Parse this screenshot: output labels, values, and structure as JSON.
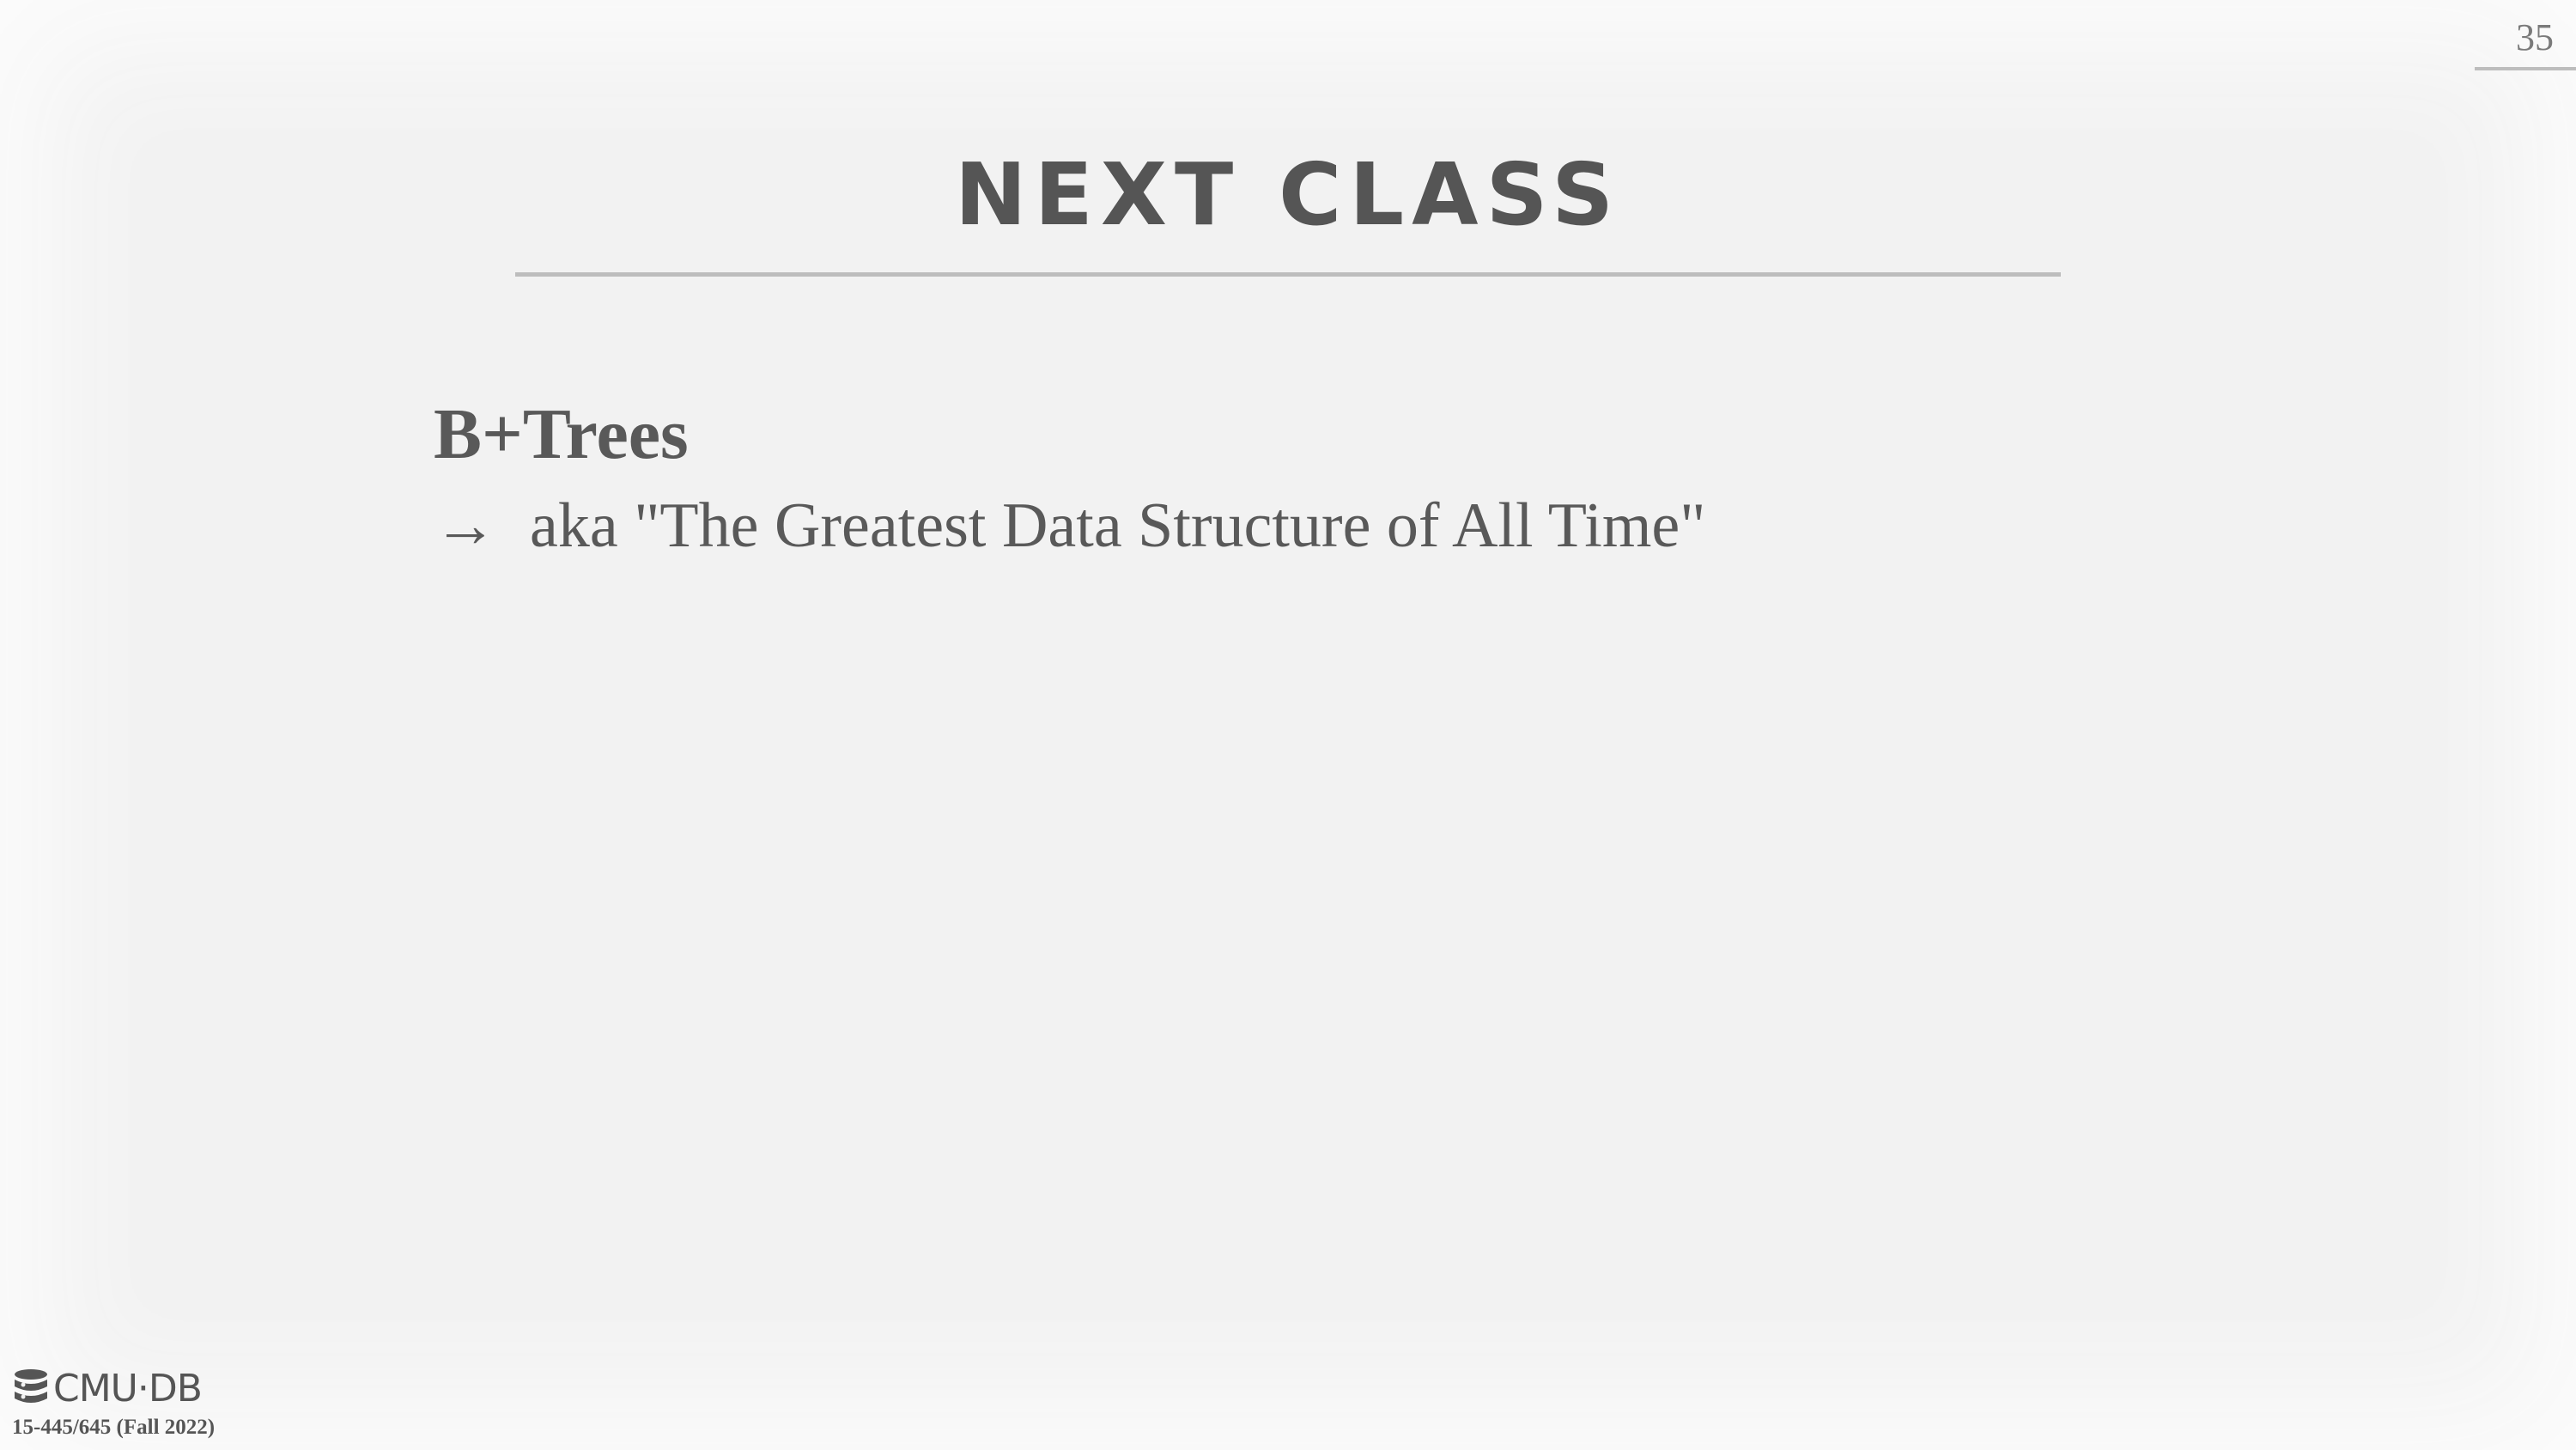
{
  "slide": {
    "page_number": "35",
    "title": "NEXT CLASS",
    "item": {
      "heading": "B+Trees",
      "sub_bullet": "→",
      "sub_text": "aka \"The Greatest Data Structure of All Time\""
    },
    "footer": {
      "logo_text": "CMU·DB",
      "logo_icon": "database-icon",
      "course": "15-445/645 (Fall 2022)"
    }
  },
  "colors": {
    "background": "#f2f2f2",
    "text": "#555555",
    "rule": "#bdbdbd"
  }
}
